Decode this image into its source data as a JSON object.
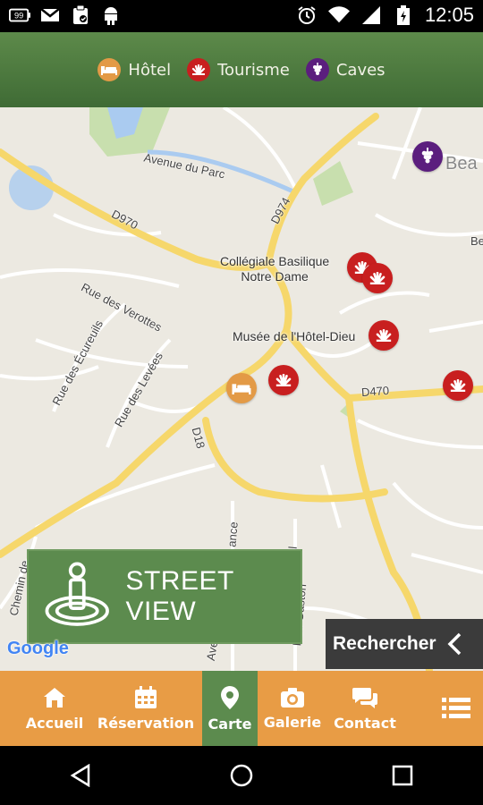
{
  "status_bar": {
    "time": "12:05",
    "battery_badge": "99",
    "icons": [
      "battery-99-icon",
      "gmail-icon",
      "clipboard-icon",
      "android-icon",
      "alarm-icon",
      "wifi-icon",
      "signal-icon",
      "battery-icon"
    ]
  },
  "categories": [
    {
      "label": "Hôtel",
      "icon": "bed-icon",
      "color": "#e39a46"
    },
    {
      "label": "Tourisme",
      "icon": "fan-icon",
      "color": "#c81f1f"
    },
    {
      "label": "Caves",
      "icon": "grapes-icon",
      "color": "#5b1e7e"
    }
  ],
  "map": {
    "streets": {
      "avenue_du_parc": "Avenue du Parc",
      "d970": "D970",
      "d974": "D974",
      "d470": "D470",
      "d18": "D18",
      "rue_verottes": "Rue des Verottes",
      "rue_ecureuils": "Rue des Écureuils",
      "rue_levees": "Rue des Levées",
      "chemin": "Chemin de",
      "ave_partial": "Ave",
      "ance_partial": "ance",
      "gaston_partial": "Rue Gaston",
      "nel_partial": "nel",
      "bea_partial": "Bea",
      "be_partial": "Be"
    },
    "pois": {
      "collegiale": "Collégiale Basilique\nNotre Dame",
      "musee": "Musée de l'Hôtel-Dieu"
    },
    "google": "Google"
  },
  "street_view": {
    "label": "STREET VIEW"
  },
  "search": {
    "label": "Rechercher"
  },
  "bottom_nav": [
    {
      "label": "Accueil",
      "icon": "home-icon"
    },
    {
      "label": "Réservation",
      "icon": "calendar-icon"
    },
    {
      "label": "Carte",
      "icon": "map-pin-icon",
      "active": true
    },
    {
      "label": "Galerie",
      "icon": "camera-icon"
    },
    {
      "label": "Contact",
      "icon": "chat-icon"
    }
  ],
  "colors": {
    "header_green": "#4f7c43",
    "nav_orange": "#e89c45",
    "active_green": "#5c8b4e",
    "tourism_red": "#c81f1f",
    "hotel_orange": "#e39a46",
    "cave_purple": "#5b1e7e"
  }
}
